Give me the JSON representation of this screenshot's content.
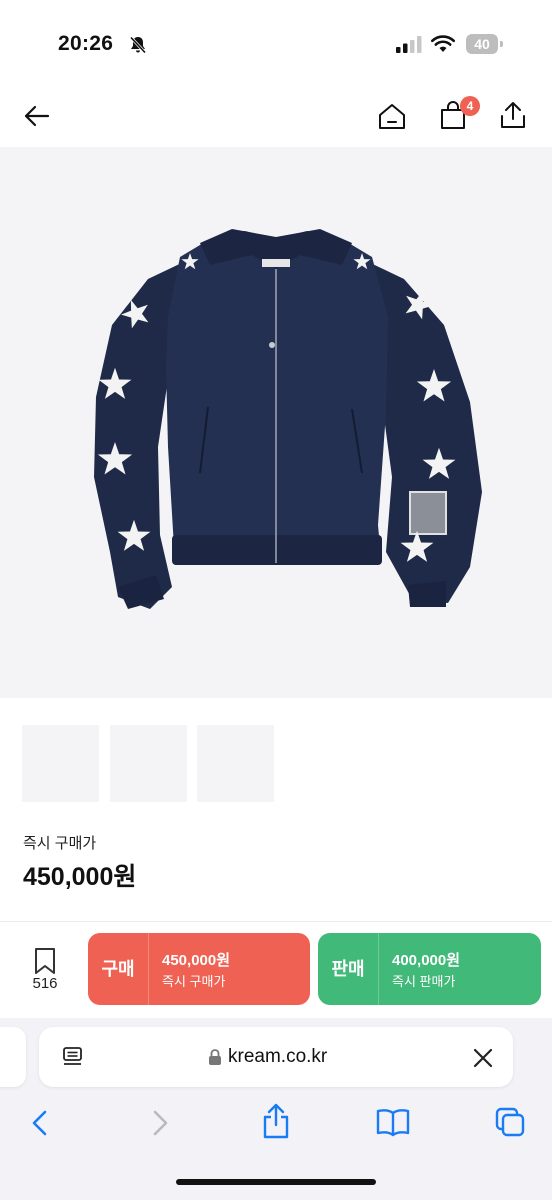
{
  "status_bar": {
    "time": "20:26",
    "battery": "40"
  },
  "header": {
    "cart_count": "4"
  },
  "product": {
    "price_label": "즉시 구매가",
    "price": "450,000원"
  },
  "bottom_bar": {
    "bookmark_count": "516",
    "buy": {
      "label": "구매",
      "price": "450,000원",
      "sub": "즉시 구매가"
    },
    "sell": {
      "label": "판매",
      "price": "400,000원",
      "sub": "즉시 판매가"
    }
  },
  "browser": {
    "url": "kream.co.kr"
  },
  "colors": {
    "buy": "#ef6253",
    "sell": "#41b979",
    "badge": "#ef6253",
    "jacket": "#1f2a48",
    "safari_blue": "#1a7cf5"
  },
  "icons": [
    "bell-slash-icon",
    "signal-icon",
    "wifi-icon",
    "battery-icon",
    "back-arrow-icon",
    "home-icon",
    "shopping-bag-icon",
    "share-icon",
    "bookmark-icon",
    "reader-icon",
    "lock-icon",
    "close-icon",
    "safari-back-icon",
    "safari-forward-icon",
    "safari-share-icon",
    "bookmarks-book-icon",
    "tabs-icon"
  ]
}
